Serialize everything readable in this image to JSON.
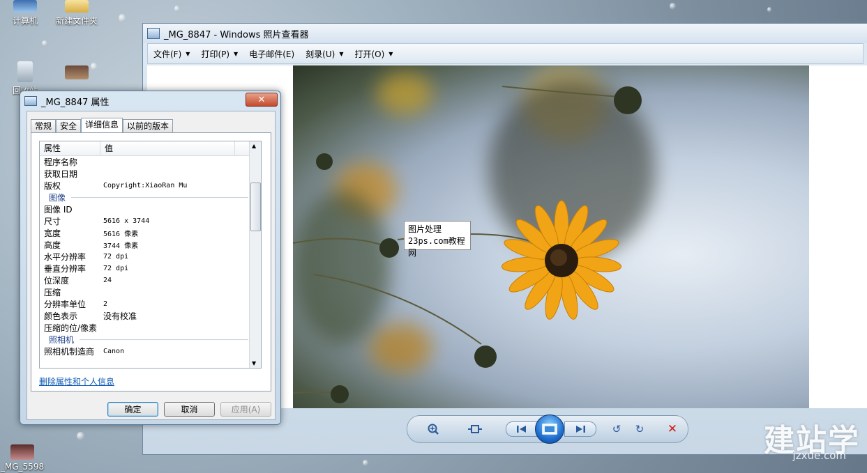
{
  "desktop": {
    "icons": [
      {
        "label": "计算机"
      },
      {
        "label": "新建文件夹"
      },
      {
        "label": "回收站"
      },
      {
        "label": "_MG_5598"
      }
    ]
  },
  "viewer": {
    "title": "_MG_8847 - Windows 照片查看器",
    "menu": [
      {
        "label": "文件(F)"
      },
      {
        "label": "打印(P)"
      },
      {
        "label": "电子邮件(E)"
      },
      {
        "label": "刻录(U)"
      },
      {
        "label": "打开(O)"
      }
    ],
    "watermark": {
      "line1": "图片处理",
      "line2": "23ps.com教程网"
    }
  },
  "dialog": {
    "title": "_MG_8847 属性",
    "close": "✕",
    "tabs": [
      "常规",
      "安全",
      "详细信息",
      "以前的版本"
    ],
    "columns": {
      "property": "属性",
      "value": "值"
    },
    "rows_top": [
      {
        "k": "程序名称",
        "v": ""
      },
      {
        "k": "获取日期",
        "v": ""
      },
      {
        "k": "版权",
        "v": "Copyright:XiaoRan Mu"
      }
    ],
    "group_image": "图像",
    "rows_image": [
      {
        "k": "图像 ID",
        "v": ""
      },
      {
        "k": "尺寸",
        "v": "5616 x 3744"
      },
      {
        "k": "宽度",
        "v": "5616 像素"
      },
      {
        "k": "高度",
        "v": "3744 像素"
      },
      {
        "k": "水平分辨率",
        "v": "72 dpi"
      },
      {
        "k": "垂直分辨率",
        "v": "72 dpi"
      },
      {
        "k": "位深度",
        "v": "24"
      },
      {
        "k": "压缩",
        "v": ""
      },
      {
        "k": "分辨率单位",
        "v": "2"
      },
      {
        "k": "颜色表示",
        "v": "没有校准"
      },
      {
        "k": "压缩的位/像素",
        "v": ""
      }
    ],
    "group_camera": "照相机",
    "rows_camera": [
      {
        "k": "照相机制造商",
        "v": "Canon"
      }
    ],
    "link": "删除属性和个人信息",
    "buttons": {
      "ok": "确定",
      "cancel": "取消",
      "apply": "应用(A)"
    }
  },
  "logo": {
    "main": "建站学",
    "sub": "jzxue.com"
  }
}
